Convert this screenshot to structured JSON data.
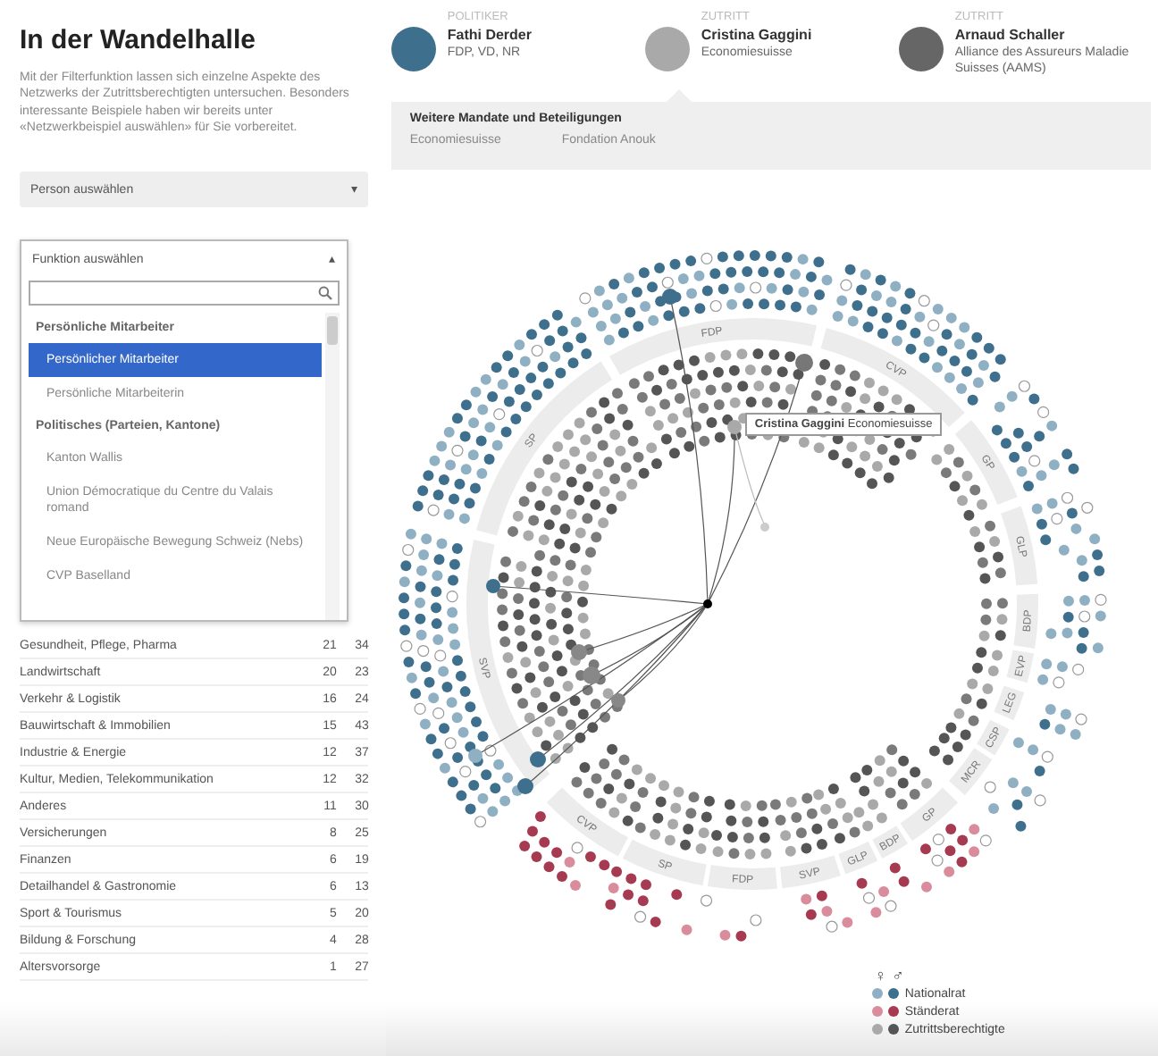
{
  "title": "In der Wandelhalle",
  "intro": "Mit der Filterfunktion lassen sich einzelne Aspekte des Netzwerks der Zutrittsberechtigten untersuchen. Besonders interessante Beispiele haben wir bereits unter «Netzwerkbeispiel auswählen» für Sie vorbereitet.",
  "person_select": {
    "placeholder": "Person auswählen",
    "caret": "▾"
  },
  "function_select": {
    "label": "Funktion auswählen",
    "caret": "▴",
    "expanded": true,
    "options": [
      {
        "kind": "group",
        "label": "Persönliche Mitarbeiter"
      },
      {
        "kind": "option",
        "label": "Persönlicher Mitarbeiter",
        "selected": true
      },
      {
        "kind": "option",
        "label": "Persönliche Mitarbeiterin",
        "selected": false
      },
      {
        "kind": "group",
        "label": "Politisches (Parteien, Kantone)"
      },
      {
        "kind": "option",
        "label": "Kanton Wallis",
        "selected": false
      },
      {
        "kind": "option",
        "label": "Union Démocratique du Centre du Valais romand",
        "selected": false
      },
      {
        "kind": "option",
        "label": "Neue Europäische Bewegung Schweiz (Nebs)",
        "selected": false
      },
      {
        "kind": "option",
        "label": "CVP Baselland",
        "selected": false
      }
    ]
  },
  "sectors": [
    {
      "name": "Gesundheit, Pflege, Pharma",
      "column_2": "21",
      "column_3": "34"
    },
    {
      "name": "Landwirtschaft",
      "column_2": "20",
      "column_3": "23"
    },
    {
      "name": "Verkehr & Logistik",
      "column_2": "16",
      "column_3": "24"
    },
    {
      "name": "Bauwirtschaft & Immobilien",
      "column_2": "15",
      "column_3": "43"
    },
    {
      "name": "Industrie & Energie",
      "column_2": "12",
      "column_3": "37"
    },
    {
      "name": "Kultur, Medien, Telekommunikation",
      "column_2": "12",
      "column_3": "32"
    },
    {
      "name": "Anderes",
      "column_2": "11",
      "column_3": "30"
    },
    {
      "name": "Versicherungen",
      "column_2": "8",
      "column_3": "25"
    },
    {
      "name": "Finanzen",
      "column_2": "6",
      "column_3": "19"
    },
    {
      "name": "Detailhandel & Gastronomie",
      "column_2": "6",
      "column_3": "13"
    },
    {
      "name": "Sport & Tourismus",
      "column_2": "5",
      "column_3": "20"
    },
    {
      "name": "Bildung & Forschung",
      "column_2": "4",
      "column_3": "28"
    },
    {
      "name": "Altersvorsorge",
      "column_2": "1",
      "column_3": "27"
    }
  ],
  "people": [
    {
      "role": "POLITIKER",
      "name": "Fathi Derder",
      "detail": "FDP, VD, NR",
      "color": "#3e6f8c",
      "selected": false
    },
    {
      "role": "ZUTRITT",
      "name": "Cristina Gaggini",
      "detail": "Economiesuisse",
      "color": "#a9a9a9",
      "selected": true
    },
    {
      "role": "ZUTRITT",
      "name": "Arnaud Schaller",
      "detail": "Alliance des Assureurs Maladie Suisses (AAMS)",
      "color": "#666666",
      "selected": false
    }
  ],
  "mandates": {
    "title": "Weitere Mandate und Beteiligungen",
    "items": [
      "Economiesuisse",
      "Fondation Anouk"
    ]
  },
  "chart": {
    "parties": [
      "SVP",
      "SP",
      "FDP",
      "CVP",
      "GP",
      "GLP",
      "BDP",
      "EVP",
      "LEG",
      "CSP",
      "MCR",
      "GP",
      "BDP",
      "GLP",
      "SVP",
      "FDP",
      "SP",
      "CVP"
    ],
    "tooltip": "**Cristina Gaggini** Economiesuisse"
  },
  "legend": {
    "genders": [
      "♀",
      "♂"
    ],
    "rows": [
      {
        "label": "Nationalrat",
        "dots": [
          {
            "color": "#8fb0c2"
          },
          {
            "color": "#3e6f8c"
          }
        ]
      },
      {
        "label": "Ständerat",
        "dots": [
          {
            "color": "#d98c9b"
          },
          {
            "color": "#a63a50"
          }
        ]
      },
      {
        "label": "Zutrittsberechtigte",
        "dots": [
          {
            "color": "#a9a9a9"
          },
          {
            "color": "#555555"
          }
        ]
      }
    ]
  }
}
